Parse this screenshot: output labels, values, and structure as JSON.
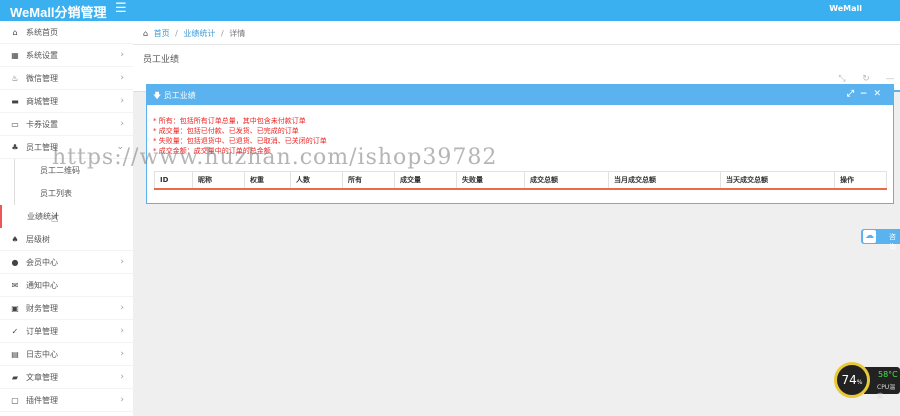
{
  "app": {
    "title": "WeMall分销管理",
    "menu_icon": "hamburger-icon",
    "top_right": "WeMall"
  },
  "sidebar": {
    "items": [
      {
        "label": "系统首页",
        "icon": "home-icon",
        "arrow": ""
      },
      {
        "label": "系统设置",
        "icon": "grid-icon",
        "arrow": "›"
      },
      {
        "label": "微信管理",
        "icon": "flame-icon",
        "arrow": "›"
      },
      {
        "label": "商城管理",
        "icon": "cart-icon",
        "arrow": "›"
      },
      {
        "label": "卡券设置",
        "icon": "card-icon",
        "arrow": "›"
      },
      {
        "label": "员工管理",
        "icon": "sitemap-icon",
        "arrow": "⌄"
      }
    ],
    "subitems": [
      {
        "label": "员工二维码"
      },
      {
        "label": "员工列表"
      },
      {
        "label": "业绩统计"
      }
    ],
    "items2": [
      {
        "label": "层级树",
        "icon": "bell-icon",
        "arrow": ""
      },
      {
        "label": "会员中心",
        "icon": "user-icon",
        "arrow": "›"
      },
      {
        "label": "通知中心",
        "icon": "envelope-icon",
        "arrow": ""
      },
      {
        "label": "财务管理",
        "icon": "money-icon",
        "arrow": "›"
      },
      {
        "label": "订单管理",
        "icon": "check-icon",
        "arrow": "›"
      },
      {
        "label": "日志中心",
        "icon": "log-icon",
        "arrow": "›"
      },
      {
        "label": "文章管理",
        "icon": "folder-icon",
        "arrow": "›"
      },
      {
        "label": "插件管理",
        "icon": "plugin-icon",
        "arrow": "›"
      }
    ]
  },
  "breadcrumb": {
    "home": "首页",
    "parent": "业绩统计",
    "current": "详情",
    "sep": "/"
  },
  "page": {
    "title": "员工业绩"
  },
  "panel": {
    "title": "员工业绩",
    "notes": [
      "* 所有：包括所有订单总量，其中包含未付款订单",
      "* 成交量：包括已付款、已发货、已完成的订单",
      "* 失败量：包括退货中、已退货、已取消、已关闭的订单",
      "* 成交金额：成交量中的订单的总金额"
    ],
    "columns": [
      "ID",
      "昵称",
      "权重",
      "人数",
      "所有",
      "成交量",
      "失败量",
      "成交总额",
      "当月成交总额",
      "当天成交总额",
      "操作"
    ]
  },
  "watermark": "https://www.huzhan.com/ishop39782",
  "float_button": {
    "label": "咨询"
  },
  "cpu": {
    "percent": "74",
    "unit": "%",
    "temp": "58°C",
    "label": "CPU温度"
  },
  "colors": {
    "topbar": "#3ab0f0",
    "panel": "#5ab2ee",
    "note_red": "#e22",
    "table_rule": "#ea6a4a",
    "gauge": "#e8c93a"
  }
}
